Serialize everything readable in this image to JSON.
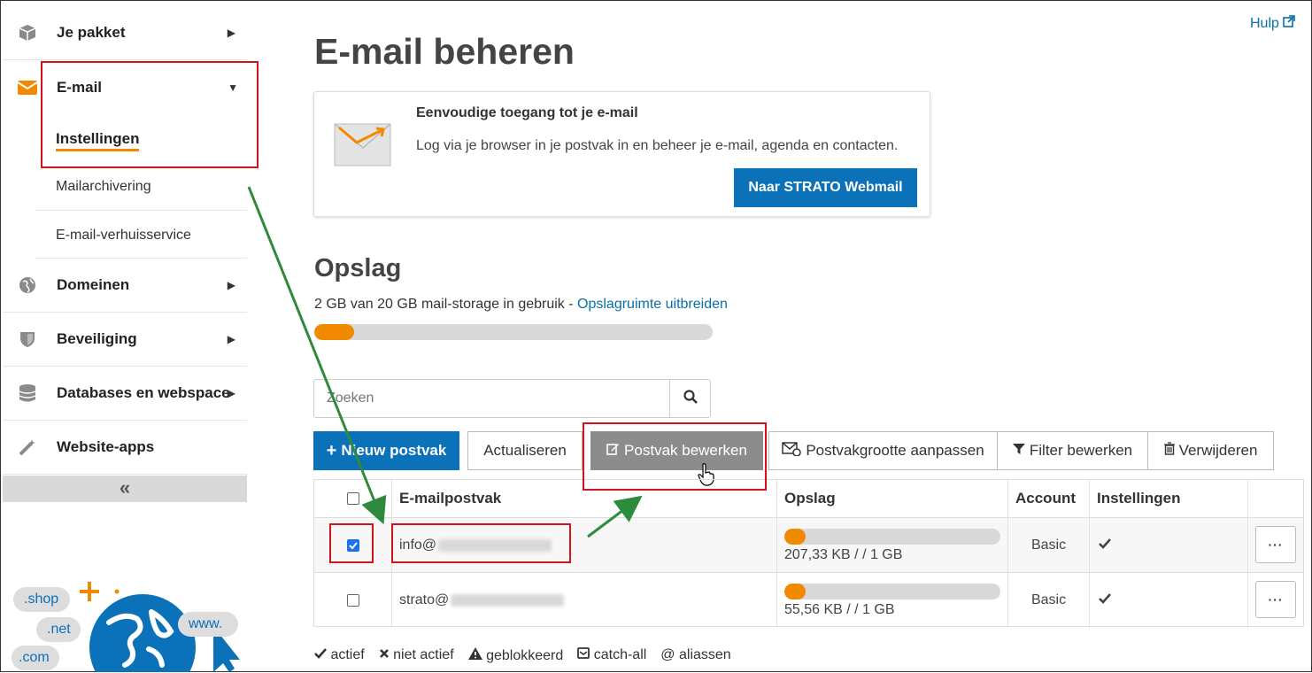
{
  "sidebar": {
    "items": [
      {
        "label": "Je pakket",
        "icon": "package-icon"
      },
      {
        "label": "E-mail",
        "icon": "envelope-icon"
      },
      {
        "label": "Domeinen",
        "icon": "globe-icon"
      },
      {
        "label": "Beveiliging",
        "icon": "shield-icon"
      },
      {
        "label": "Databases en webspace",
        "icon": "database-icon"
      },
      {
        "label": "Website-apps",
        "icon": "magic-wand-icon"
      }
    ],
    "email_sub": [
      "Instellingen",
      "Mailarchivering",
      "E-mail-verhuisservice"
    ],
    "collapse": "«",
    "promo": {
      "shop": ".shop",
      "net": ".net",
      "com": ".com",
      "www": "www."
    }
  },
  "header": {
    "title": "E-mail beheren",
    "help": "Hulp"
  },
  "webmail_card": {
    "title": "Eenvoudige toegang tot je e-mail",
    "text": "Log via je browser in je postvak in en beheer je e-mail, agenda en contacten.",
    "button": "Naar STRATO Webmail"
  },
  "storage": {
    "heading": "Opslag",
    "usage": "2 GB van 20 GB mail-storage in gebruik - ",
    "link": "Opslagruimte uitbreiden",
    "used_fraction": 0.1
  },
  "search": {
    "placeholder": "Zoeken"
  },
  "toolbar": {
    "new": "Nieuw postvak",
    "refresh": "Actualiseren",
    "edit": "Postvak bewerken",
    "resize": "Postvakgrootte aanpassen",
    "filter": "Filter bewerken",
    "delete": "Verwijderen"
  },
  "table": {
    "headers": [
      "E-mailpostvak",
      "Opslag",
      "Account",
      "Instellingen"
    ],
    "rows": [
      {
        "mailbox": "info@",
        "storage": "207,33 KB / / 1 GB",
        "account": "Basic",
        "checked": true,
        "used_fraction": 0.06
      },
      {
        "mailbox": "strato@",
        "storage": "55,56 KB / / 1 GB",
        "account": "Basic",
        "checked": false,
        "used_fraction": 0.06
      }
    ],
    "more": "···"
  },
  "legend": {
    "active": "actief",
    "inactive": "niet actief",
    "blocked": "geblokkeerd",
    "catchall": "catch-all",
    "aliases": "@ aliassen"
  },
  "colors": {
    "accent": "#0b71b8",
    "orange": "#f28a00",
    "annotation_red": "#d3131c",
    "annotation_green": "#2e8b3e"
  }
}
